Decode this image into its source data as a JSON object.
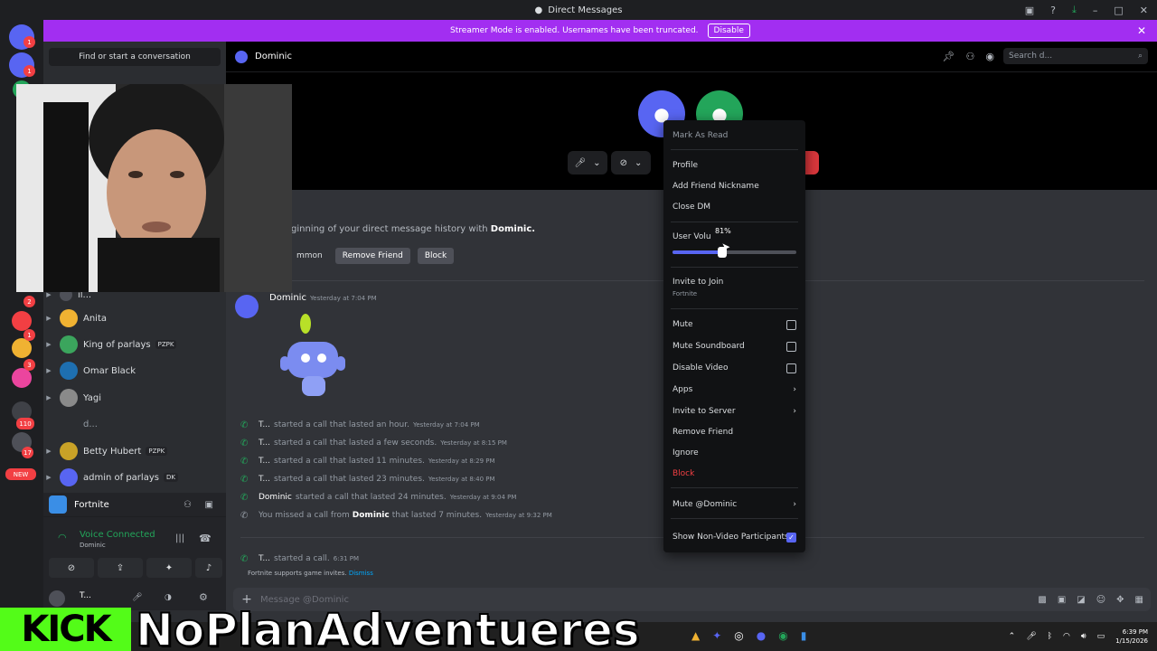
{
  "titlebar": {
    "title": "Direct Messages"
  },
  "banner": {
    "text": "Streamer Mode is enabled. Usernames have been truncated.",
    "disable_label": "Disable"
  },
  "rail": {
    "badges": [
      "1",
      "1",
      "2",
      "1",
      "2",
      "3",
      "110",
      "17"
    ],
    "new_label": "NEW"
  },
  "sidebar": {
    "find_label": "Find or start a conversation",
    "dms": [
      {
        "name": "Anita",
        "tag": ""
      },
      {
        "name": "King of parlays",
        "tag": "PZPK"
      },
      {
        "name": "Omar Black",
        "tag": ""
      },
      {
        "name": "Yagi",
        "tag": ""
      },
      {
        "name": "d...",
        "tag": ""
      },
      {
        "name": "Betty Hubert",
        "tag": "PZPK"
      },
      {
        "name": "admin of parlays",
        "tag": "DK"
      }
    ],
    "partial_top": "il..."
  },
  "activity": {
    "game": "Fortnite"
  },
  "voice": {
    "status": "Voice Connected",
    "channel": "Dominic"
  },
  "user": {
    "name": "T..."
  },
  "header": {
    "channel_name": "Dominic",
    "search_placeholder": "Search d..."
  },
  "intro": {
    "prefix": "ginning of your direct message history with",
    "name": "Dominic.",
    "common_label": "mmon",
    "remove_friend": "Remove Friend",
    "block": "Block"
  },
  "message": {
    "author": "Dominic",
    "time": "Yesterday at 7:04 PM"
  },
  "call_logs": [
    {
      "who": "T...",
      "text": "started a call that lasted an hour.",
      "time": "Yesterday at 7:04 PM",
      "missed": false
    },
    {
      "who": "T...",
      "text": "started a call that lasted a few seconds.",
      "time": "Yesterday at 8:15 PM",
      "missed": false
    },
    {
      "who": "T...",
      "text": "started a call that lasted 11 minutes.",
      "time": "Yesterday at 8:29 PM",
      "missed": false
    },
    {
      "who": "T...",
      "text": "started a call that lasted 23 minutes.",
      "time": "Yesterday at 8:40 PM",
      "missed": false
    },
    {
      "who": "Dominic",
      "text": "started a call that lasted 24 minutes.",
      "time": "Yesterday at 9:04 PM",
      "missed": false
    }
  ],
  "missed_call": {
    "prefix": "You missed a call from",
    "who": "Dominic",
    "suffix": "that lasted 7 minutes.",
    "time": "Yesterday at 9:32 PM"
  },
  "current_call": {
    "who": "T...",
    "text": "started a call.",
    "time": "6:31 PM"
  },
  "invite_note": {
    "text": "Fortnite supports game invites.",
    "dismiss": "Dismiss"
  },
  "composer": {
    "placeholder": "Message @Dominic"
  },
  "context_menu": {
    "mark_read": "Mark As Read",
    "profile": "Profile",
    "add_nickname": "Add Friend Nickname",
    "close_dm": "Close DM",
    "user_volume": "User Volu",
    "volume_percent": "81%",
    "volume_value": 81,
    "invite_join": "Invite to Join",
    "invite_join_sub": "Fortnite",
    "mute": "Mute",
    "mute_soundboard": "Mute Soundboard",
    "disable_video": "Disable Video",
    "apps": "Apps",
    "invite_server": "Invite to Server",
    "remove_friend": "Remove Friend",
    "ignore": "Ignore",
    "block": "Block",
    "mute_user": "Mute @Dominic",
    "show_non_video": "Show Non-Video Participants"
  },
  "overlay": {
    "kick": "KICK",
    "channel": "NoPlanAdventueres"
  },
  "clock": {
    "time": "6:39 PM",
    "date": "1/15/2026"
  },
  "colors": {
    "accent": "#5865f2",
    "banner": "#a22ef1",
    "kick_green": "#53fc18",
    "danger": "#f23f43",
    "online": "#23a55a"
  }
}
